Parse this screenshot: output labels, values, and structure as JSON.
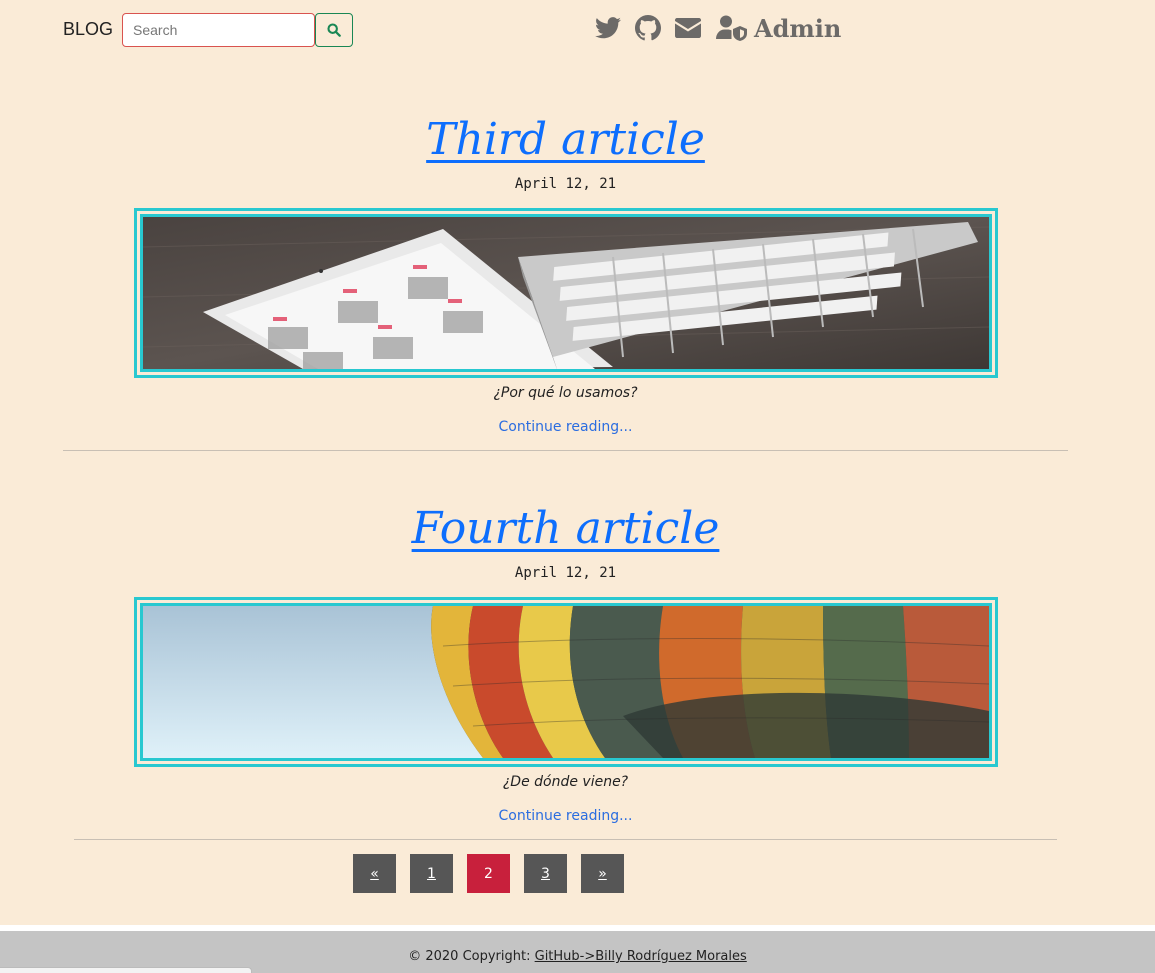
{
  "navbar": {
    "brand": "BLOG",
    "search": {
      "placeholder": "Search",
      "value": ""
    },
    "icons": [
      "twitter-icon",
      "github-icon",
      "envelope-icon",
      "user-shield-icon"
    ],
    "admin_label": "Admin"
  },
  "articles": [
    {
      "title": "Third article",
      "date": "April 12, 21",
      "subtitle": "¿Por qué lo usamos?",
      "continue": "Continue reading..."
    },
    {
      "title": "Fourth article",
      "date": "April 12, 21",
      "subtitle": "¿De dónde viene?",
      "continue": "Continue reading..."
    }
  ],
  "pagination": {
    "prev": "«",
    "pages": [
      "1",
      "2",
      "3"
    ],
    "current": "2",
    "next": "»"
  },
  "footer": {
    "copyright": "© 2020 Copyright: ",
    "link": "GitHub->Billy Rodríguez Morales"
  },
  "colors": {
    "background": "#faebd7",
    "link": "#0d6efd",
    "frame": "#28c8d0",
    "page_active": "#c8203c",
    "page_default": "#565656",
    "footer": "#c4c4c4"
  }
}
